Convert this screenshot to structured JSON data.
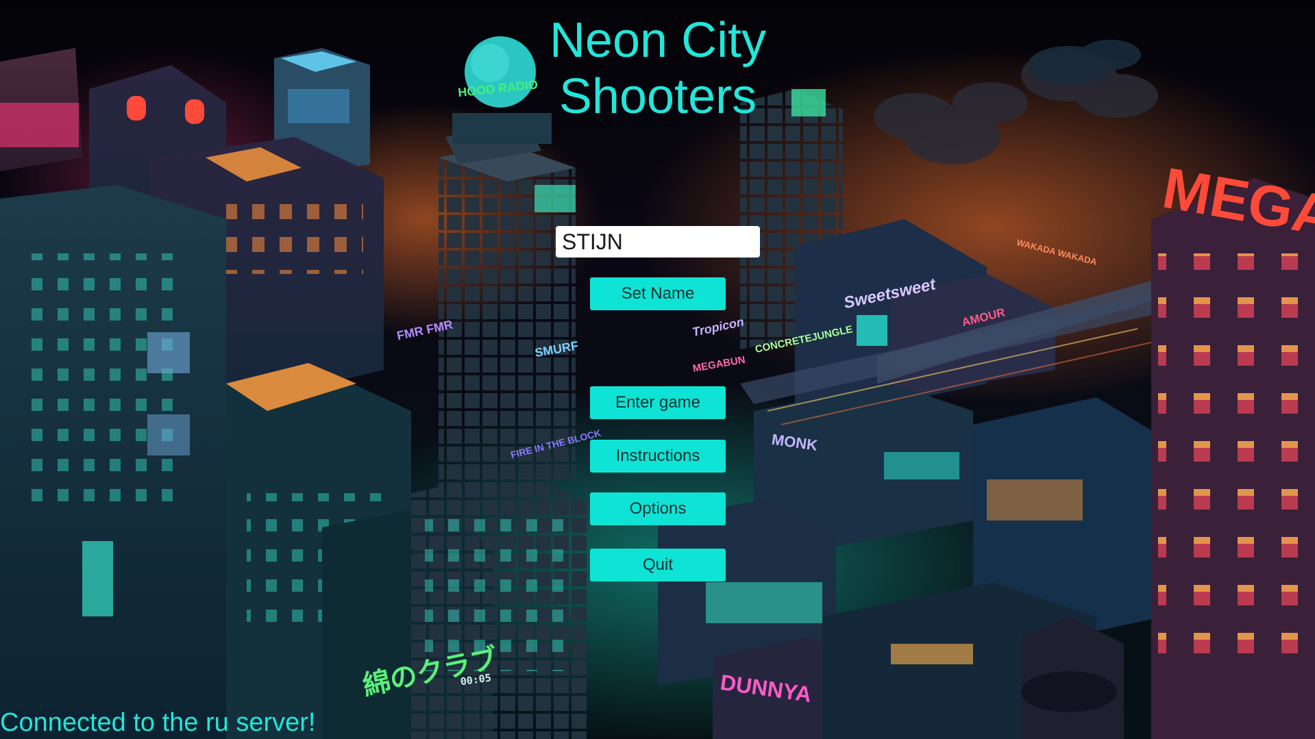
{
  "game": {
    "title_line1": "Neon City",
    "title_line2": "Shooters"
  },
  "name_form": {
    "name_value": "STIJN",
    "set_name_label": "Set Name"
  },
  "menu": {
    "enter_game_label": "Enter game",
    "instructions_label": "Instructions",
    "options_label": "Options",
    "quit_label": "Quit"
  },
  "status": {
    "connection_text": "Connected to the ru server!"
  },
  "background": {
    "signs": {
      "hood_radio": "HOOD RADIO",
      "mega": "MEGA",
      "fmr": "FMR FMR",
      "dunnya_smurf": "SMURF",
      "sweet_sweet": "Sweetsweet",
      "tropicon": "Tropicon",
      "megabun": "MEGABUN",
      "concrete_jungle": "CONCRETEJUNGLE",
      "amour": "AMOUR",
      "wakada": "WAKADA WAKADA",
      "fire_in_the_block": "FIRE IN THE BLOCK",
      "monk": "MONK",
      "dunnya": "DUNNYA",
      "jp_club": "綿のクラブ",
      "clock": "00:05"
    }
  },
  "colors": {
    "accent": "#0fe3d5",
    "title": "#22e6d9",
    "background": "#05060c"
  }
}
